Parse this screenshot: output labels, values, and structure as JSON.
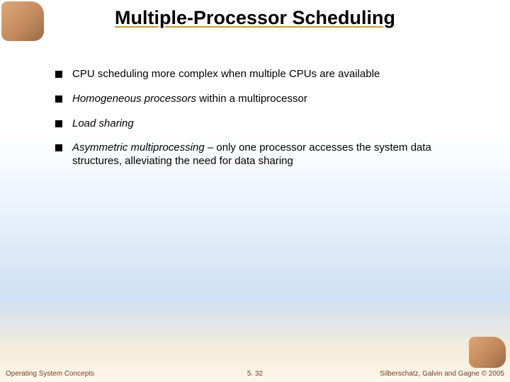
{
  "title": "Multiple-Processor Scheduling",
  "bullets": [
    {
      "pre": "",
      "em": "",
      "post": "CPU scheduling more complex when multiple CPUs are available"
    },
    {
      "pre": "",
      "em": "Homogeneous processors",
      "post": " within a multiprocessor"
    },
    {
      "pre": "",
      "em": "Load sharing",
      "post": ""
    },
    {
      "pre": "",
      "em": "Asymmetric multiprocessing",
      "post": " – only one processor accesses the system data structures, alleviating the need for data sharing"
    }
  ],
  "footer": {
    "left": "Operating System Concepts",
    "center": "5. 32",
    "right": "Silberschatz, Galvin and Gagne © 2005"
  },
  "icons": {
    "corner": "dinosaur-illustration"
  }
}
